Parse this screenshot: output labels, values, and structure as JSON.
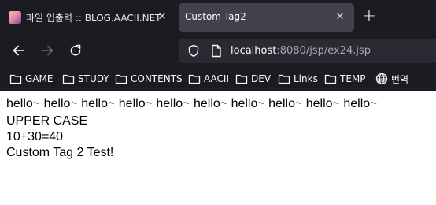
{
  "tabs": [
    {
      "title": "파일 입출력 :: BLOG.AACII.NET",
      "active": false
    },
    {
      "title": "Custom Tag2",
      "active": true
    }
  ],
  "address_bar": {
    "host": "localhost",
    "rest": ":8080/jsp/ex24.jsp"
  },
  "bookmarks": [
    {
      "label": "GAME",
      "icon": "folder-icon"
    },
    {
      "label": "STUDY",
      "icon": "folder-icon"
    },
    {
      "label": "CONTENTS",
      "icon": "folder-icon"
    },
    {
      "label": "AACII",
      "icon": "folder-icon"
    },
    {
      "label": "DEV",
      "icon": "folder-icon"
    },
    {
      "label": "Links",
      "icon": "folder-icon"
    },
    {
      "label": "TEMP",
      "icon": "folder-icon"
    },
    {
      "label": "번역",
      "icon": "globe-icon"
    }
  ],
  "content": {
    "line1": "hello~ hello~ hello~ hello~ hello~ hello~ hello~ hello~ hello~ hello~",
    "line2": "UPPER CASE",
    "line3": "10+30=40",
    "line4": "Custom Tag 2 Test!"
  },
  "colors": {
    "chrome_bg": "#1c1b22",
    "active_tab": "#42414d",
    "urlbar_bg": "#2b2a33",
    "page_bg": "#ffffff"
  }
}
